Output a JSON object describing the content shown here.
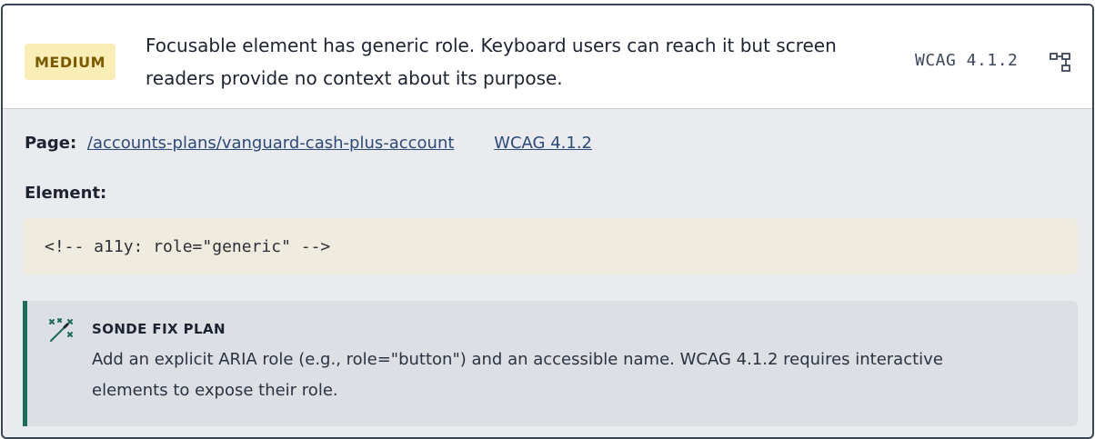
{
  "issue": {
    "severity": "MEDIUM",
    "message": "Focusable element has generic role. Keyboard users can reach it but screen readers provide no context about its purpose.",
    "wcag_code": "WCAG 4.1.2",
    "tree_icon": "structure-icon"
  },
  "details": {
    "page_label": "Page:",
    "page_path": "/accounts-plans/vanguard-cash-plus-account",
    "wcag_link": "WCAG 4.1.2",
    "element_label": "Element:",
    "element_code": "<!-- a11y: role=\"generic\" -->"
  },
  "fix": {
    "icon": "magic-wand-icon",
    "title": "SONDE FIX PLAN",
    "text": "Add an explicit ARIA role (e.g., role=\"button\") and an accessible name. WCAG 4.1.2 requires interactive elements to expose their role."
  },
  "colors": {
    "badge_bg": "#fbedb6",
    "badge_text": "#7a5a00",
    "link": "#2c4a78",
    "fix_accent": "#1f6b5a",
    "code_bg": "#f0ebdf"
  }
}
